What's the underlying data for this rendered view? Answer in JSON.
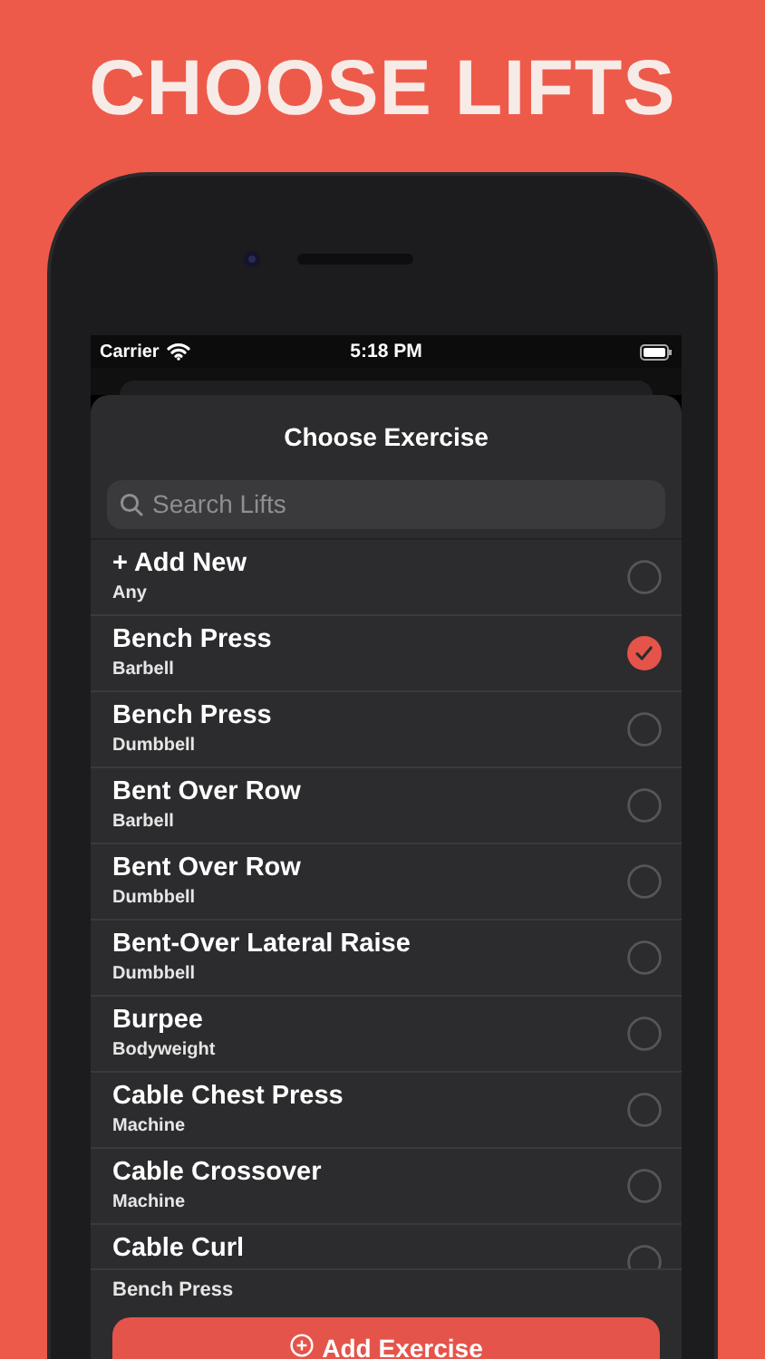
{
  "headline": "CHOOSE LIFTS",
  "status_bar": {
    "carrier": "Carrier",
    "time": "5:18 PM"
  },
  "sheet": {
    "title": "Choose Exercise",
    "search": {
      "placeholder": "Search Lifts"
    }
  },
  "exercises": [
    {
      "name": "+ Add New",
      "category": "Any",
      "selected": false
    },
    {
      "name": "Bench Press",
      "category": "Barbell",
      "selected": true
    },
    {
      "name": "Bench Press",
      "category": "Dumbbell",
      "selected": false
    },
    {
      "name": "Bent Over Row",
      "category": "Barbell",
      "selected": false
    },
    {
      "name": "Bent Over Row",
      "category": "Dumbbell",
      "selected": false
    },
    {
      "name": "Bent-Over Lateral Raise",
      "category": "Dumbbell",
      "selected": false
    },
    {
      "name": "Burpee",
      "category": "Bodyweight",
      "selected": false
    },
    {
      "name": "Cable Chest Press",
      "category": "Machine",
      "selected": false
    },
    {
      "name": "Cable Crossover",
      "category": "Machine",
      "selected": false
    },
    {
      "name": "Cable Curl",
      "selected": false
    }
  ],
  "footer": {
    "current": "Bench Press",
    "button": "Add Exercise"
  }
}
